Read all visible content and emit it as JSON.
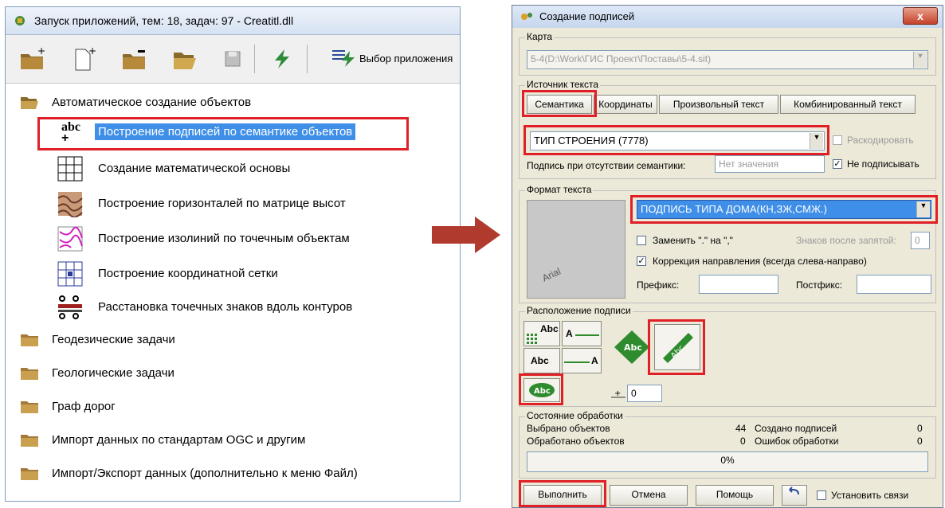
{
  "left_window": {
    "title": "Запуск приложений, тем: 18, задач: 97 - Creatitl.dll",
    "toolbar": {
      "icons": [
        "new-folder-icon",
        "new-document-icon",
        "remove-folder-icon",
        "open-folder-icon",
        "save-icon",
        "lightning-icon"
      ],
      "select_app_label": "Выбор приложения"
    },
    "tree": {
      "open_group": "Автоматическое создание объектов",
      "items": [
        {
          "label": "Построение подписей по семантике объектов",
          "icon": "abc-label-icon",
          "icon_text": "abc",
          "selected": true
        },
        {
          "label": "Создание математической основы",
          "icon": "grid-icon"
        },
        {
          "label": "Построение горизонталей по матрице высот",
          "icon": "contour-icon"
        },
        {
          "label": "Построение изолиний по точечным объектам",
          "icon": "isoline-icon"
        },
        {
          "label": "Построение координатной сетки",
          "icon": "coord-grid-icon"
        },
        {
          "label": "Расстановка точечных знаков вдоль контуров",
          "icon": "line-symbols-icon"
        }
      ],
      "groups": [
        "Геодезические задачи",
        "Геологические задачи",
        "Граф дорог",
        "Импорт данных по стандартам OGC и другим",
        "Импорт/Экспорт данных (дополнительно к меню Файл)"
      ]
    }
  },
  "dialog": {
    "title": "Создание подписей",
    "close_label": "x",
    "map": {
      "legend": "Карта",
      "value": "5-4(D:\\Work\\ГИС Проект\\Поставы\\5-4.sit)"
    },
    "text_source": {
      "legend": "Источник текста",
      "tabs": [
        "Семантика",
        "Координаты",
        "Произвольный текст",
        "Комбинированный текст"
      ],
      "semantic_value": "ТИП СТРОЕНИЯ (7778)",
      "decode_label": "Раскодировать",
      "missing_label": "Подпись при отсутствии семантики:",
      "missing_placeholder": "Нет значения",
      "no_sign_label": "Не подписывать"
    },
    "text_format": {
      "legend": "Формат текста",
      "preview_font": "Arial",
      "format_value": "ПОДПИСЬ ТИПА ДОМА(КН,ЗЖ,СМЖ.)",
      "replace_label": "Заменить \".\" на \",\"",
      "decimals_label": "Знаков после запятой:",
      "decimals_value": "0",
      "direction_label": "Коррекция направления (всегда слева-направо)",
      "prefix_label": "Префикс:",
      "postfix_label": "Постфикс:"
    },
    "placement": {
      "legend": "Расположение подписи",
      "abc": "Abc",
      "a": "A",
      "offset_value": "0"
    },
    "status": {
      "legend": "Состояние обработки",
      "selected_label": "Выбрано объектов",
      "selected_value": "44",
      "created_label": "Создано подписей",
      "created_value": "0",
      "processed_label": "Обработано объектов",
      "processed_value": "0",
      "errors_label": "Ошибок обработки",
      "errors_value": "0",
      "progress_text": "0%",
      "progress": 0
    },
    "buttons": {
      "run": "Выполнить",
      "cancel": "Отмена",
      "help": "Помощь",
      "link_label": "Установить связи"
    }
  },
  "colors": {
    "highlight": "#e02026",
    "selection": "#3f8fe8",
    "arrow": "#b03a2e",
    "green": "#2e8b2e"
  }
}
